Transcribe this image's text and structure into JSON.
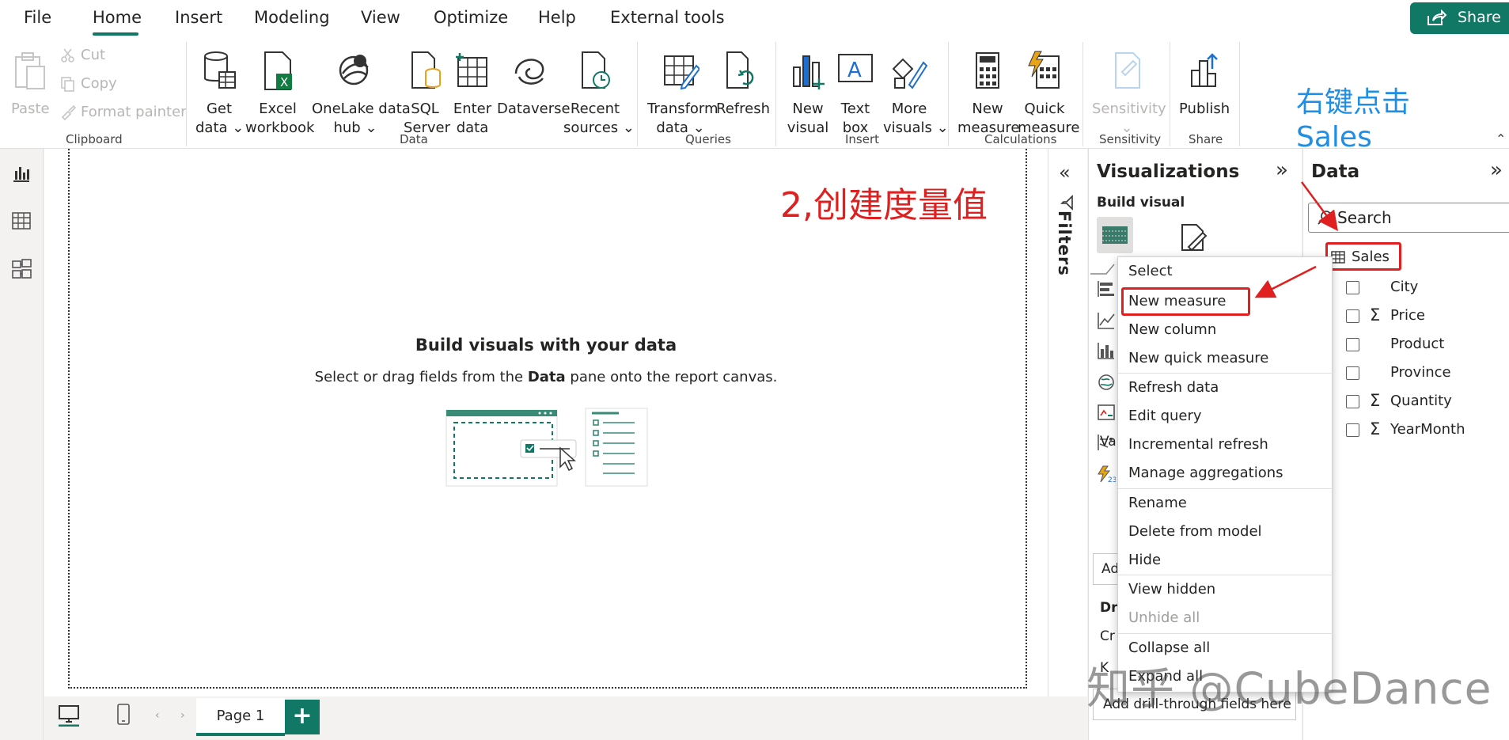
{
  "menu": {
    "items": [
      "File",
      "Home",
      "Insert",
      "Modeling",
      "View",
      "Optimize",
      "Help",
      "External tools"
    ],
    "active": "Home",
    "share_label": "Share"
  },
  "ribbon": {
    "clipboard": {
      "paste": "Paste",
      "cut": "Cut",
      "copy": "Copy",
      "format_painter": "Format painter",
      "group": "Clipboard"
    },
    "data": {
      "get_data": [
        "Get",
        "data"
      ],
      "excel": [
        "Excel",
        "workbook"
      ],
      "onelake": [
        "OneLake data",
        "hub"
      ],
      "sql": [
        "SQL",
        "Server"
      ],
      "enter": [
        "Enter",
        "data"
      ],
      "dataverse": [
        "Dataverse"
      ],
      "recent": [
        "Recent",
        "sources"
      ],
      "group": "Data"
    },
    "queries": {
      "transform": [
        "Transform",
        "data"
      ],
      "refresh": [
        "Refresh"
      ],
      "group": "Queries"
    },
    "insert": {
      "new_visual": [
        "New",
        "visual"
      ],
      "text_box": [
        "Text",
        "box"
      ],
      "more_visuals": [
        "More",
        "visuals"
      ],
      "group": "Insert"
    },
    "calculations": {
      "new_measure": [
        "New",
        "measure"
      ],
      "quick_measure": [
        "Quick",
        "measure"
      ],
      "group": "Calculations"
    },
    "sensitivity": {
      "label": [
        "Sensitivity"
      ],
      "group": "Sensitivity"
    },
    "share": {
      "publish": [
        "Publish"
      ],
      "group": "Share"
    }
  },
  "canvas": {
    "empty_title": "Build visuals with your data",
    "empty_sub_pre": "Select or drag fields from the ",
    "empty_sub_bold": "Data",
    "empty_sub_post": " pane onto the report canvas.",
    "annotation": "2,创建度量值"
  },
  "pages": {
    "tabs": [
      "Page 1"
    ],
    "add": "+"
  },
  "filters": {
    "label": "Filters"
  },
  "visualizations": {
    "title": "Visualizations",
    "build_visual": "Build visual",
    "partial_values": "Va",
    "partial_add": "Ad",
    "partial_drill": "Dr",
    "partial_cross": "Cr",
    "partial_keep": "K",
    "drill_placeholder": "Add drill-through fields here"
  },
  "data_pane": {
    "title": "Data",
    "search_placeholder": "Search",
    "table": "Sales",
    "fields": [
      {
        "name": "City",
        "sigma": ""
      },
      {
        "name": "Price",
        "sigma": "Σ"
      },
      {
        "name": "Product",
        "sigma": ""
      },
      {
        "name": "Province",
        "sigma": ""
      },
      {
        "name": "Quantity",
        "sigma": "Σ"
      },
      {
        "name": "YearMonth",
        "sigma": "Σ"
      }
    ],
    "annotation_line1": "右键点击",
    "annotation_line2": "Sales"
  },
  "context_menu": {
    "items": [
      {
        "label": "Select",
        "disabled": false
      },
      {
        "label": "New measure",
        "disabled": false
      },
      {
        "label": "New column",
        "disabled": false
      },
      {
        "label": "New quick measure",
        "disabled": false
      },
      {
        "label": "Refresh data",
        "disabled": false
      },
      {
        "label": "Edit query",
        "disabled": false
      },
      {
        "label": "Incremental refresh",
        "disabled": false
      },
      {
        "label": "Manage aggregations",
        "disabled": false
      },
      {
        "label": "Rename",
        "disabled": false
      },
      {
        "label": "Delete from model",
        "disabled": false
      },
      {
        "label": "Hide",
        "disabled": false
      },
      {
        "label": "View hidden",
        "disabled": false
      },
      {
        "label": "Unhide all",
        "disabled": true
      },
      {
        "label": "Collapse all",
        "disabled": false
      },
      {
        "label": "Expand all",
        "disabled": false
      }
    ]
  },
  "watermark": "知乎 @CubeDance",
  "colors": {
    "accent": "#117865",
    "annotation_red": "#e02020",
    "annotation_blue": "#1f8fe6"
  }
}
